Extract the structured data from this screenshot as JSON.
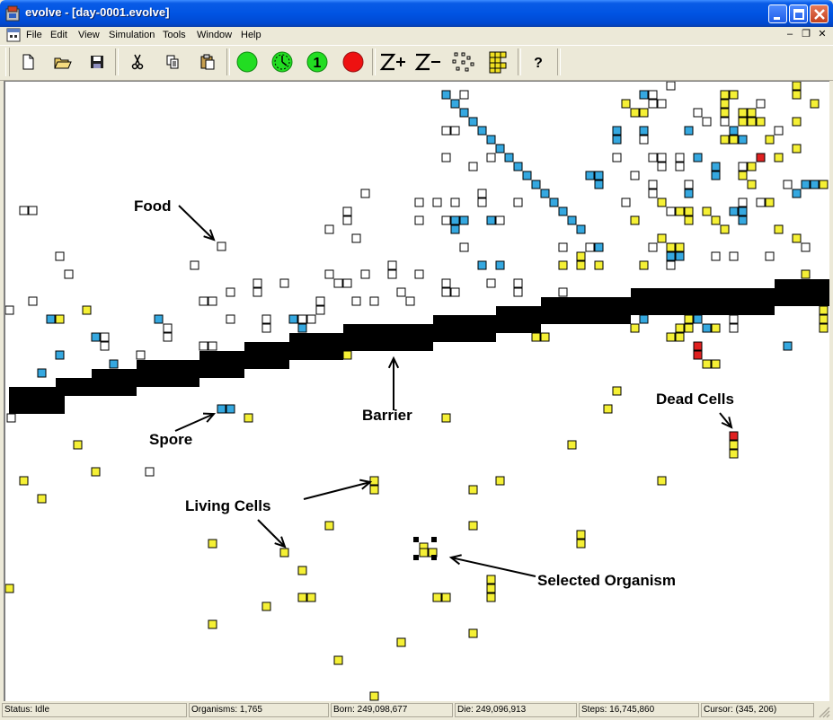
{
  "window": {
    "title": "evolve - [day-0001.evolve]"
  },
  "menu": [
    "File",
    "Edit",
    "View",
    "Simulation",
    "Tools",
    "Window",
    "Help"
  ],
  "toolbar": {
    "buttons": [
      "new-icon",
      "open-icon",
      "save-icon",
      "cut-icon",
      "copy-icon",
      "paste-icon",
      "go-icon",
      "timed-icon",
      "single-step-icon",
      "stop-icon",
      "zoom-in-icon",
      "zoom-out-icon",
      "dots-icon",
      "grid-icon",
      "help-icon"
    ],
    "step_label": "1",
    "colors": {
      "go": "#22dd22",
      "stop": "#ee1111",
      "grid": "#f0e020"
    }
  },
  "annotations": {
    "food": "Food",
    "spore": "Spore",
    "barrier": "Barrier",
    "living_cells": "Living Cells",
    "dead_cells": "Dead Cells",
    "selected_organism": "Selected Organism"
  },
  "colors": {
    "living": "#f5f035",
    "spore": "#35a8e0",
    "dead": "#e02020",
    "barrier": "#000000",
    "food": "#ffffff"
  },
  "status": {
    "state": "Status: Idle",
    "organisms": "Organisms: 1,765",
    "born": "Born: 249,098,677",
    "die": "Die: 249,096,913",
    "steps": "Steps: 16,745,860",
    "cursor": "Cursor: (345, 206)"
  }
}
